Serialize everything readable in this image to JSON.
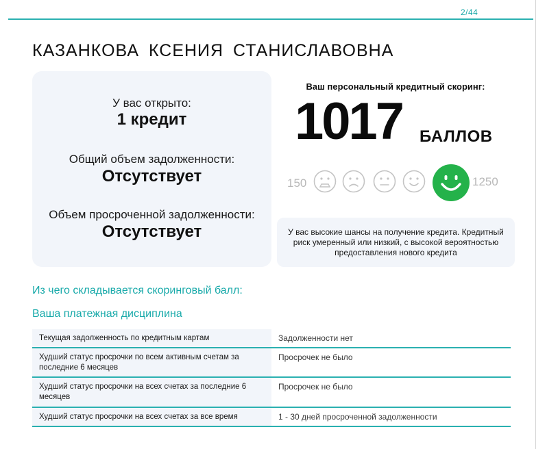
{
  "page": {
    "number": "2/44"
  },
  "person": {
    "name": "КАЗАНКОВА КСЕНИЯ СТАНИСЛАВОВНА"
  },
  "summary": {
    "open_label": "У вас открыто:",
    "open_value": "1 кредит",
    "debt_label": "Общий объем задолженности:",
    "debt_value": "Отсутствует",
    "overdue_label": "Объем просроченной задолженности:",
    "overdue_value": "Отсутствует"
  },
  "score": {
    "title": "Ваш персональный кредитный скоринг:",
    "value": "1017",
    "unit": "БАЛЛОВ",
    "scale_min": "150",
    "scale_max": "1250",
    "faces": [
      "sad-face-icon",
      "frown-face-icon",
      "neutral-face-icon",
      "smile-face-icon",
      "happy-face-icon"
    ],
    "active_face": 4,
    "active_color": "#24b24a",
    "inactive_color": "#c4c4c4",
    "note": "У вас высокие шансы на получение кредита. Кредитный риск умеренный или низкий, с высокой вероятностью предоставления нового кредита"
  },
  "sections": {
    "scoring_title": "Из чего складывается скоринговый балл:",
    "discipline_title": "Ваша платежная дисциплина"
  },
  "discipline_table": [
    {
      "label": "Текущая задолженность по кредитным картам",
      "value": "Задолженности нет"
    },
    {
      "label": "Худший статус просрочки по всем активным счетам за последние 6 месяцев",
      "value": "Просрочек не было"
    },
    {
      "label": "Худший статус просрочки на всех счетах за последние 6 месяцев",
      "value": "Просрочек не было"
    },
    {
      "label": "Худший статус просрочки на всех счетах за все время",
      "value": "1 - 30 дней просроченной задолженности"
    }
  ],
  "theme": {
    "accent": "#2ab0b0",
    "card_bg": "#f2f5fa"
  }
}
